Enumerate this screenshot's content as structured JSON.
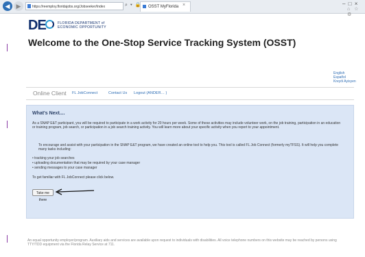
{
  "browser": {
    "url": "https://reemploy.floridajobs.org/Jobseeker/Index",
    "tab_title": "OSST MyFlorida",
    "controls": "⌕ ▾ 🔒 ↻",
    "tab_close": "×",
    "window_controls": "– □ ×",
    "toolbar_icons": "⌂ ☆ ⚙"
  },
  "logo": {
    "mark": "DE",
    "line1": "FLORIDA DEPARTMENT of",
    "line2": "ECONOMIC OPPORTUNITY"
  },
  "page_title": "Welcome to the One-Stop Service Tracking System (OSST)",
  "languages": [
    "English",
    "Español",
    "Kreyòl Ayisyen"
  ],
  "nav": {
    "title": "Online Client",
    "links": [
      "FL JobConnect",
      "Contact Us",
      "Logout (ANDER… )"
    ]
  },
  "panel": {
    "heading": "What's Next....",
    "intro": "As a SNAP E&T participant, you will be required to participate in a work activity for 20 hours per week. Some of these activities may include volunteer work, on the job training, participation in an education or training program, job search, or participation in a job search training activity. You will learn more about your specific activity when you report to your appointment.",
    "encourage": "To encourage and assist with your participation in the SNAP E&T program, we have created an online tool to help you. This tool is called FL Job Connect (formerly myTFSS). It will help you complete many tasks including:",
    "bullets": [
      "• tracking your job searches",
      "• uploading documentation that may be required by your case manager",
      "• sending messages to your case manager"
    ],
    "familiar": "To get familiar with FL JobConnect please click below.",
    "button": "Take me there"
  },
  "footer": "An equal opportunity employer/program. Auxiliary aids and services are available upon request to individuals with disabilities. All voice telephone numbers on this website may be reached by persons using TTY/TDD equipment via the Florida Relay Service at 711."
}
